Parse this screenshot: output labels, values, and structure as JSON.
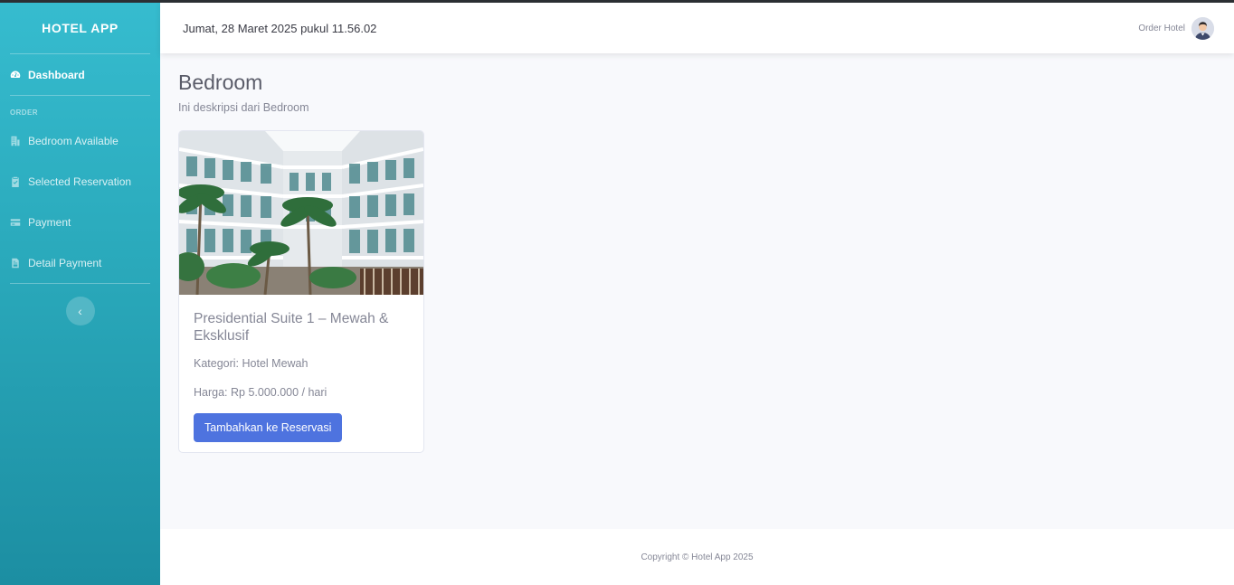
{
  "sidebar": {
    "brand": "HOTEL APP",
    "dashboard_label": "Dashboard",
    "section_heading": "ORDER",
    "items": [
      {
        "label": "Bedroom Available"
      },
      {
        "label": "Selected Reservation"
      },
      {
        "label": "Payment"
      },
      {
        "label": "Detail Payment"
      }
    ],
    "toggle_symbol": "‹"
  },
  "topbar": {
    "datetime": "Jumat, 28 Maret 2025 pukul 11.56.02",
    "user_name": "Order Hotel"
  },
  "page": {
    "title": "Bedroom",
    "description": "Ini deskripsi dari Bedroom"
  },
  "rooms": [
    {
      "title": "Presidential Suite 1 – Mewah & Eksklusif",
      "category": "Kategori: Hotel Mewah",
      "price": "Harga: Rp 5.000.000 / hari",
      "button_label": "Tambahkan ke Reservasi"
    }
  ],
  "footer": {
    "copyright": "Copyright © Hotel App 2025"
  },
  "colors": {
    "sidebar_top": "#36bccf",
    "sidebar_bottom": "#1c8ea2",
    "primary_button": "#4e73df",
    "page_background": "#f8f9fc"
  },
  "icons": {
    "dashboard": "tachometer-icon",
    "bedroom": "building-icon",
    "reservation": "clipboard-check-icon",
    "payment": "credit-card-icon",
    "detail_payment": "file-invoice-icon",
    "toggle": "chevron-left-icon"
  }
}
